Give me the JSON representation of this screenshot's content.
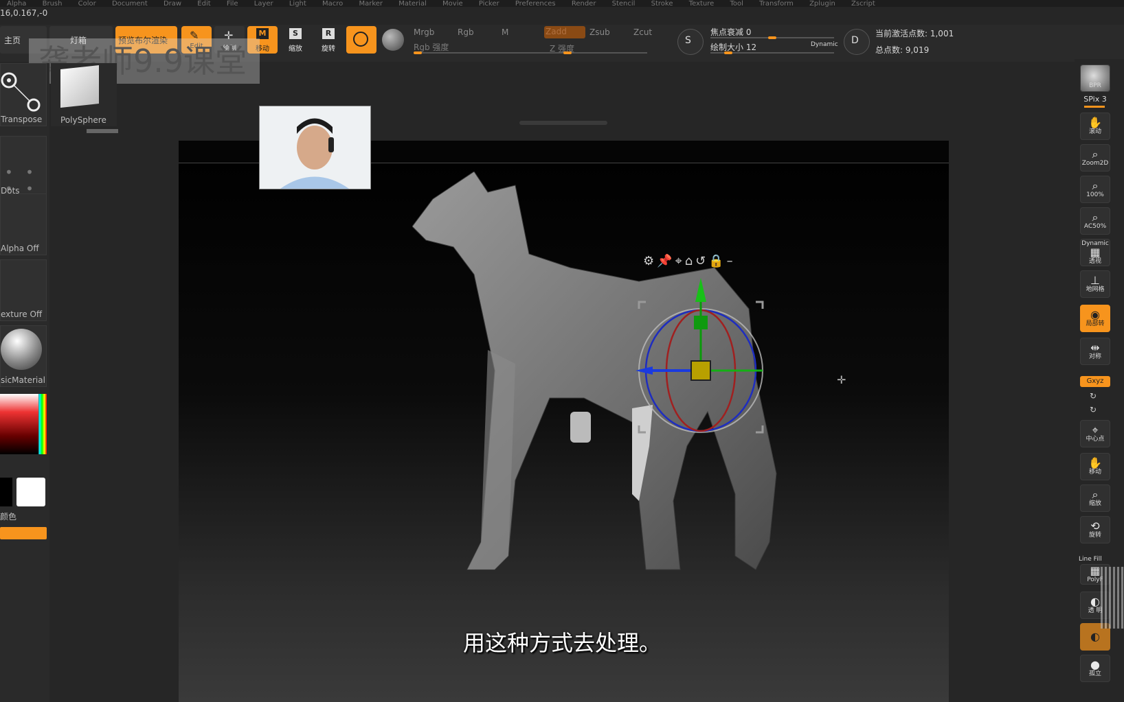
{
  "top_menu": [
    "Alpha",
    "Brush",
    "Color",
    "Document",
    "Draw",
    "Edit",
    "File",
    "Layer",
    "Light",
    "Macro",
    "Marker",
    "Material",
    "Movie",
    "Picker",
    "Preferences",
    "Render",
    "Stencil",
    "Stroke",
    "Texture",
    "Tool",
    "Transform",
    "Zplugin",
    "Zscript"
  ],
  "coords_readout": "16,0.167,-0",
  "watermark": "龚老师9.9课堂",
  "toolbar": {
    "home": "主页",
    "lightbox": "灯箱",
    "preview_bpr": "预览布尔渲染",
    "edit": "Edit",
    "draw": "绘制",
    "move": "移动",
    "scale": "缩放",
    "rotate": "旋转",
    "mrgb": "Mrgb",
    "rgb": "Rgb",
    "m": "M",
    "zadd": "Zadd",
    "zsub": "Zsub",
    "zcut": "Zcut",
    "rgb_intensity": "Rgb 强度",
    "z_intensity": "Z 强度",
    "focal_shift": "焦点衰减 0",
    "draw_size": "绘制大小 12",
    "dynamic": "Dynamic",
    "active_points": "当前激活点数: 1,001",
    "total_points": "总点数: 9,019",
    "rgb_intensity_level": 0.0,
    "z_intensity_level": 0.2,
    "focal_shift_level": 0.5,
    "draw_size_level": 0.12
  },
  "left_tray": {
    "transpose_label": "Transpose",
    "polysphere_label": "PolySphere",
    "dots_label": "Dots",
    "alpha_label": "Alpha Off",
    "texture_label": "exture Off",
    "material_label": "sicMaterial",
    "color_label": "颜色"
  },
  "right_tray": {
    "bpr": "BPR",
    "spix": "SPix 3",
    "scroll": "滚动",
    "zoom2d": "Zoom2D",
    "hundred": "100%",
    "ac50": "AC50%",
    "perspective": "透视",
    "floor": "地网格",
    "local": "局部转",
    "symmetry": "对称",
    "xyz": "Gxyz",
    "center": "中心点",
    "move": "移动",
    "zoom": "缩放",
    "rotate": "旋转",
    "line_fill": "Line Fill",
    "polyf": "PolyF",
    "transp": "透 明",
    "solo": "孤立",
    "dynamic": "Dynamic"
  },
  "viewport": {
    "subtitle": "用这种方式去处理。"
  },
  "colors": {
    "accent": "#f7941d",
    "panel": "#2a2a2a",
    "viewport_bg": "#000000"
  }
}
